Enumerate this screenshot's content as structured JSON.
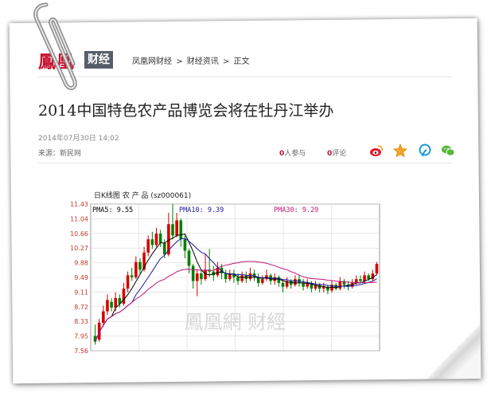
{
  "header": {
    "logo_text": "鳳凰",
    "logo_box": "财经",
    "breadcrumbs": [
      "凤凰网财经",
      ">",
      "财经资讯",
      ">",
      "正文"
    ]
  },
  "article": {
    "title": "2014中国特色农产品博览会将在牡丹江举办",
    "date": "2014年07月30日 14:02",
    "source": "来源：新民网",
    "participants_count": "0",
    "participants_label": "人参与",
    "comments_count": "0",
    "comments_label": "评论"
  },
  "share_icons": [
    "weibo-icon",
    "star-icon",
    "tencent-icon",
    "wechat-icon"
  ],
  "chart_title": "日K线图 农 产 品 (sz000061)",
  "chart_data": {
    "type": "candlestick",
    "y_ticks": [
      "11.43",
      "11.04",
      "10.66",
      "10.27",
      "9.88",
      "9.49",
      "9.11",
      "8.72",
      "8.33",
      "7.95",
      "7.56"
    ],
    "ylim": [
      7.56,
      11.43
    ],
    "legend": [
      {
        "label": "PMA5: 9.55",
        "color": "#000000"
      },
      {
        "label": "PMA10: 9.39",
        "color": "#1a1aa0"
      },
      {
        "label": "PMA30: 9.29",
        "color": "#c0157a"
      }
    ],
    "watermark": "鳳凰網 财經",
    "grid": true,
    "candles": [
      [
        7.95,
        7.8,
        8.25,
        7.72
      ],
      [
        7.85,
        8.3,
        8.4,
        7.8
      ],
      [
        8.3,
        8.6,
        8.75,
        8.2
      ],
      [
        8.6,
        8.9,
        9.05,
        8.5
      ],
      [
        8.85,
        8.7,
        8.95,
        8.6
      ],
      [
        8.7,
        8.95,
        9.1,
        8.6
      ],
      [
        8.95,
        8.8,
        9.05,
        8.7
      ],
      [
        8.8,
        9.2,
        9.35,
        8.75
      ],
      [
        9.2,
        9.55,
        9.65,
        9.1
      ],
      [
        9.55,
        9.5,
        9.75,
        9.4
      ],
      [
        9.5,
        9.9,
        10.05,
        9.45
      ],
      [
        9.9,
        9.7,
        10.0,
        9.6
      ],
      [
        9.7,
        10.15,
        10.3,
        9.65
      ],
      [
        10.15,
        10.5,
        10.6,
        10.05
      ],
      [
        10.5,
        10.35,
        10.7,
        10.25
      ],
      [
        10.35,
        10.65,
        10.8,
        10.3
      ],
      [
        10.65,
        10.4,
        10.75,
        10.3
      ],
      [
        10.4,
        10.1,
        10.5,
        10.0
      ],
      [
        10.1,
        10.9,
        11.2,
        10.05
      ],
      [
        10.9,
        10.6,
        11.43,
        10.5
      ],
      [
        10.6,
        11.0,
        11.2,
        10.55
      ],
      [
        11.0,
        10.5,
        11.05,
        10.3
      ],
      [
        10.5,
        10.2,
        10.6,
        10.0
      ],
      [
        10.2,
        9.8,
        10.25,
        9.6
      ],
      [
        9.8,
        9.4,
        9.85,
        9.2
      ],
      [
        9.4,
        9.6,
        9.7,
        9.0
      ],
      [
        9.6,
        9.45,
        9.7,
        9.3
      ],
      [
        9.45,
        9.7,
        10.1,
        9.4
      ],
      [
        9.7,
        9.65,
        10.25,
        9.5
      ],
      [
        9.65,
        9.55,
        9.8,
        9.4
      ],
      [
        9.55,
        9.75,
        9.9,
        9.5
      ],
      [
        9.75,
        9.6,
        9.85,
        9.45
      ],
      [
        9.6,
        9.45,
        9.7,
        9.35
      ],
      [
        9.45,
        9.6,
        9.7,
        9.4
      ],
      [
        9.6,
        9.5,
        9.7,
        9.35
      ],
      [
        9.5,
        9.4,
        9.6,
        9.3
      ],
      [
        9.4,
        9.55,
        9.65,
        9.35
      ],
      [
        9.55,
        9.45,
        9.65,
        9.35
      ],
      [
        9.45,
        9.6,
        9.75,
        9.4
      ],
      [
        9.6,
        9.5,
        9.7,
        9.4
      ],
      [
        9.5,
        9.35,
        9.6,
        9.25
      ],
      [
        9.35,
        9.45,
        9.55,
        9.3
      ],
      [
        9.45,
        9.55,
        9.7,
        9.4
      ],
      [
        9.55,
        9.4,
        9.6,
        9.3
      ],
      [
        9.4,
        9.5,
        9.6,
        9.3
      ],
      [
        9.5,
        9.35,
        9.55,
        9.25
      ],
      [
        9.35,
        9.25,
        9.45,
        9.1
      ],
      [
        9.25,
        9.4,
        9.5,
        9.2
      ],
      [
        9.4,
        9.3,
        9.45,
        9.2
      ],
      [
        9.3,
        9.45,
        9.55,
        9.25
      ],
      [
        9.45,
        9.35,
        9.55,
        9.25
      ],
      [
        9.35,
        9.25,
        9.45,
        9.15
      ],
      [
        9.25,
        9.35,
        9.45,
        9.2
      ],
      [
        9.35,
        9.2,
        9.4,
        9.1
      ],
      [
        9.2,
        9.3,
        9.4,
        9.15
      ],
      [
        9.3,
        9.2,
        9.35,
        9.1
      ],
      [
        9.2,
        9.25,
        9.35,
        9.1
      ],
      [
        9.25,
        9.15,
        9.3,
        9.05
      ],
      [
        9.15,
        9.3,
        9.4,
        9.1
      ],
      [
        9.3,
        9.2,
        9.35,
        9.15
      ],
      [
        9.2,
        9.4,
        9.5,
        9.15
      ],
      [
        9.4,
        9.3,
        9.45,
        9.2
      ],
      [
        9.3,
        9.25,
        9.4,
        9.15
      ],
      [
        9.25,
        9.35,
        9.45,
        9.2
      ],
      [
        9.35,
        9.45,
        9.55,
        9.3
      ],
      [
        9.45,
        9.4,
        9.55,
        9.35
      ],
      [
        9.4,
        9.55,
        9.65,
        9.35
      ],
      [
        9.55,
        9.45,
        9.6,
        9.4
      ],
      [
        9.45,
        9.6,
        9.7,
        9.4
      ],
      [
        9.6,
        9.85,
        9.9,
        9.55
      ]
    ]
  }
}
